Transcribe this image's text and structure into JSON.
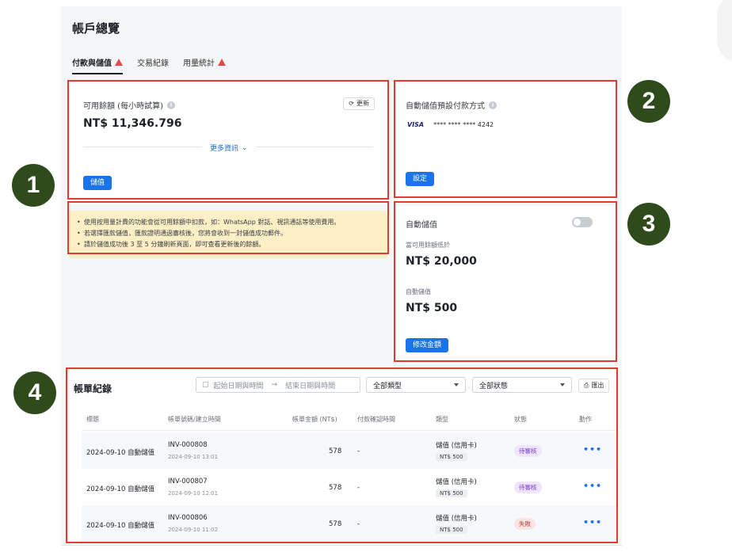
{
  "page": {
    "title": "帳戶總覽"
  },
  "tabs": [
    {
      "label": "付款與儲值",
      "active": true,
      "warning": true
    },
    {
      "label": "交易紀錄",
      "active": false,
      "warning": false
    },
    {
      "label": "用量統計",
      "active": false,
      "warning": true
    }
  ],
  "balance": {
    "label": "可用餘額 (每小時試算)",
    "refresh_label": "更新",
    "amount": "NT$ 11,346.796",
    "more_info": "更多資訊",
    "topup_label": "儲值"
  },
  "payment_method": {
    "label": "自動儲值預設付款方式",
    "brand": "VISA",
    "masked_number": "**** **** ****",
    "last4": "4242",
    "settings_label": "設定"
  },
  "notice": {
    "items": [
      "使用按用量計費的功能會從可用餘額中扣款，如：WhatsApp 對話、視訊通話等使用費用。",
      "若選擇匯款儲值，匯款證明通過審核後，您將會收到一封儲值成功郵件。",
      "請於儲值成功後 3 至 5 分鐘刷新頁面，即可查看更新後的餘額。"
    ]
  },
  "auto_topup": {
    "label": "自動儲值",
    "enabled": false,
    "threshold_label": "當可用餘額低於",
    "threshold_amount": "NT$ 20,000",
    "topup_amount_label": "自動儲值",
    "topup_amount": "NT$ 500",
    "edit_label": "修改金額"
  },
  "bills": {
    "title": "帳單紀錄",
    "start_placeholder": "起始日期與時間",
    "arrow": "→",
    "end_placeholder": "結束日期與時間",
    "type_filter": "全部類型",
    "status_filter": "全部狀態",
    "export_label": "匯出",
    "columns": [
      "標題",
      "帳單號碼/建立時間",
      "帳單金額 (NT$)",
      "付款確認時間",
      "類型",
      "狀態",
      "動作"
    ],
    "rows": [
      {
        "title": "2024-09-10 自動儲值",
        "invoice": "INV-000808",
        "created": "2024-09-10 13:01",
        "amount": "578",
        "confirmed": "-",
        "type": "儲值 (信用卡)",
        "type_tag": "NT$ 500",
        "status": "待審核",
        "status_color": "purple",
        "action": "•••"
      },
      {
        "title": "2024-09-10 自動儲值",
        "invoice": "INV-000807",
        "created": "2024-09-10 12:01",
        "amount": "578",
        "confirmed": "-",
        "type": "儲值 (信用卡)",
        "type_tag": "NT$ 500",
        "status": "待審核",
        "status_color": "purple",
        "action": "•••"
      },
      {
        "title": "2024-09-10 自動儲值",
        "invoice": "INV-000806",
        "created": "2024-09-10 11:02",
        "amount": "578",
        "confirmed": "-",
        "type": "儲值 (信用卡)",
        "type_tag": "NT$ 500",
        "status": "失敗",
        "status_color": "red",
        "action": "•••"
      }
    ]
  },
  "markers": [
    "1",
    "2",
    "3",
    "4"
  ],
  "colors": {
    "accent": "#1a73e8",
    "highlight_box": "#e23b2f",
    "marker": "#2f4b1c",
    "notice_bg": "#fdf0c7"
  }
}
